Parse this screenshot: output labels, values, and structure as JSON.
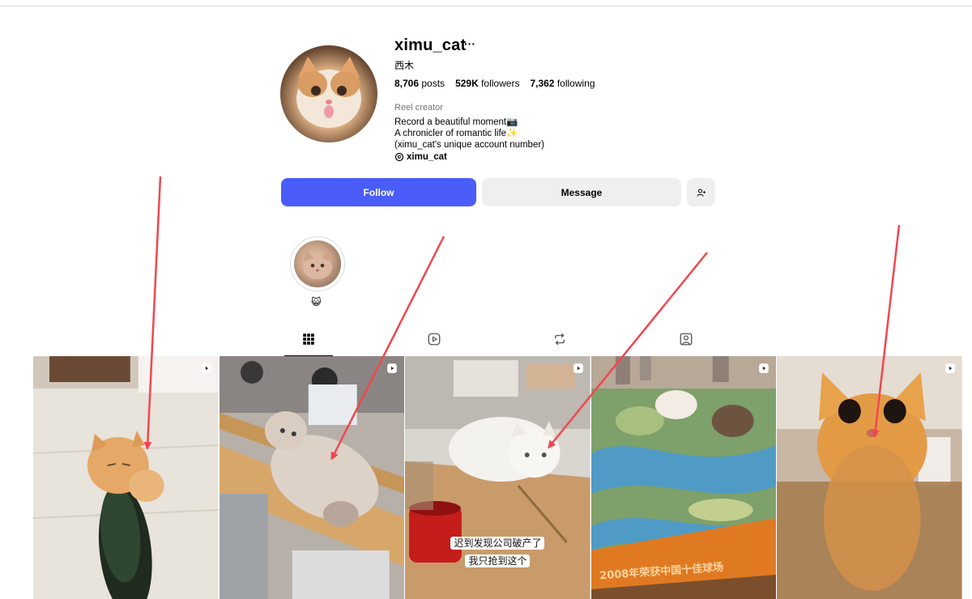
{
  "profile": {
    "username": "ximu_cat",
    "more_icon": "···",
    "full_name": "西木",
    "stats": {
      "posts_count": "8,706",
      "posts_label": "posts",
      "followers_count": "529K",
      "followers_label": "followers",
      "following_count": "7,362",
      "following_label": "following"
    },
    "category": "Reel creator",
    "bio": [
      "Record a beautiful moment📷",
      "A chronicler of romantic life✨",
      "(ximu_cat's unique account number)"
    ],
    "threads_handle": "ximu_cat"
  },
  "actions": {
    "follow": "Follow",
    "message": "Message",
    "suggest_icon": "👤+"
  },
  "highlights": [
    {
      "label": "😺"
    }
  ],
  "tabs": [
    {
      "name": "posts",
      "icon": "grid-icon",
      "active": true
    },
    {
      "name": "reels",
      "icon": "reels-icon",
      "active": false
    },
    {
      "name": "reposts",
      "icon": "repost-icon",
      "active": false
    },
    {
      "name": "tagged",
      "icon": "tagged-icon",
      "active": false
    }
  ],
  "posts": [
    {
      "type": "reel",
      "caption": []
    },
    {
      "type": "reel",
      "caption": []
    },
    {
      "type": "reel",
      "caption": [
        "迟到发现公司破产了",
        "我只抢到这个"
      ]
    },
    {
      "type": "reel",
      "caption": [],
      "banner": "2008年荣获中国十佳球场"
    },
    {
      "type": "reel",
      "caption": []
    }
  ],
  "colors": {
    "follow_button": "#4a5df9",
    "secondary_button": "#efeff2",
    "annotation_arrow": "#f0474f"
  }
}
